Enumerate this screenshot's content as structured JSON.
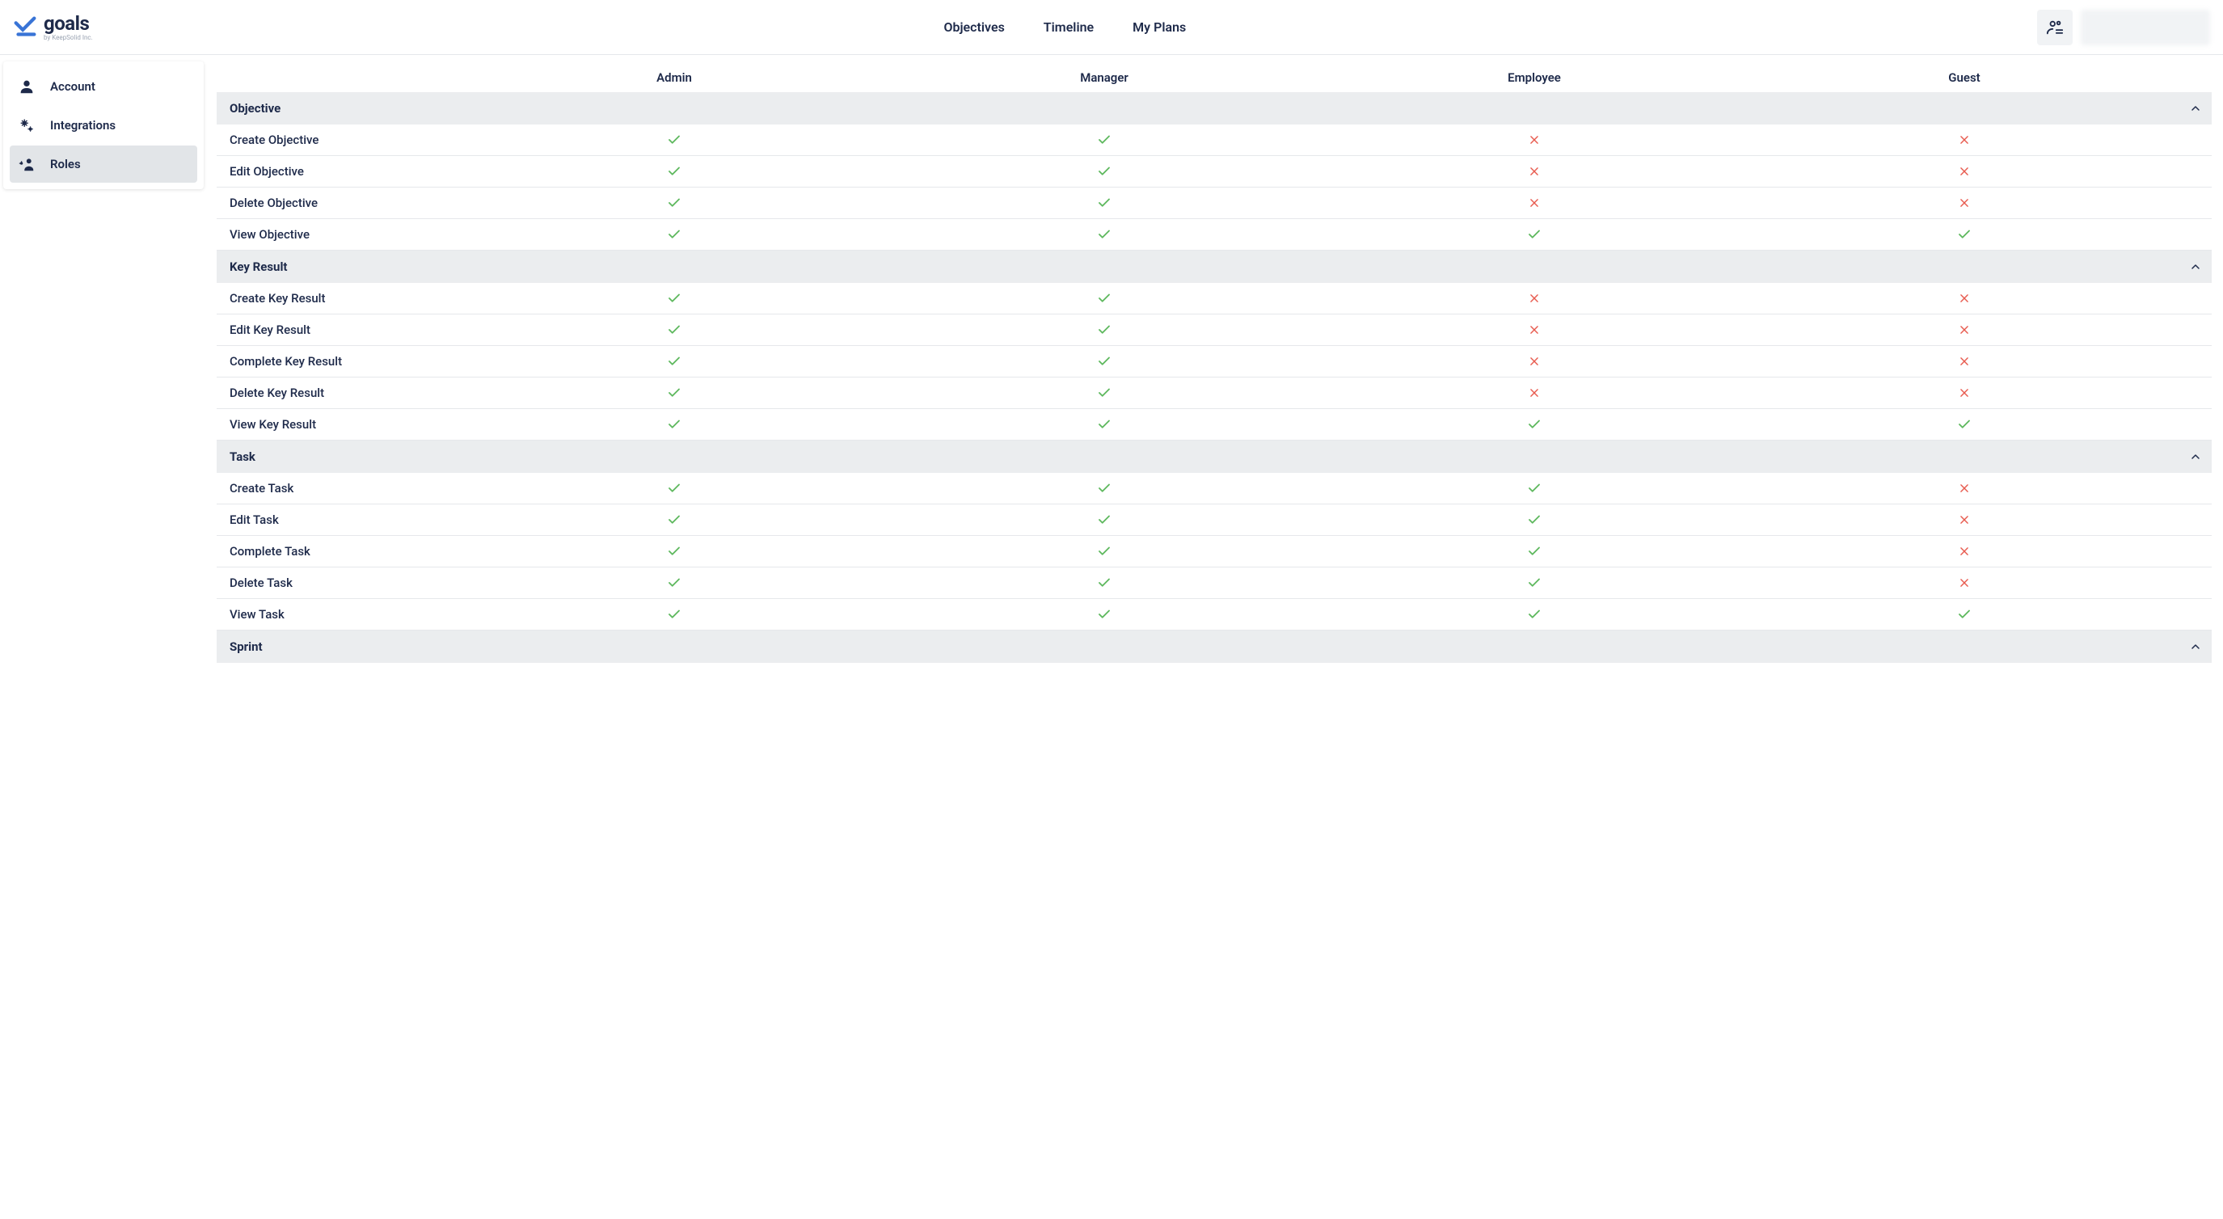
{
  "logo": {
    "title": "goals",
    "subtitle": "by KeepSolid Inc."
  },
  "nav": {
    "objectives": "Objectives",
    "timeline": "Timeline",
    "myplans": "My Plans"
  },
  "sidebar": {
    "items": [
      {
        "label": "Account"
      },
      {
        "label": "Integrations"
      },
      {
        "label": "Roles"
      }
    ]
  },
  "table": {
    "columns": [
      "",
      "Admin",
      "Manager",
      "Employee",
      "Guest"
    ],
    "sections": [
      {
        "title": "Objective",
        "rows": [
          {
            "label": "Create Objective",
            "cells": [
              true,
              true,
              false,
              false
            ]
          },
          {
            "label": "Edit Objective",
            "cells": [
              true,
              true,
              false,
              false
            ]
          },
          {
            "label": "Delete Objective",
            "cells": [
              true,
              true,
              false,
              false
            ]
          },
          {
            "label": "View Objective",
            "cells": [
              true,
              true,
              true,
              true
            ]
          }
        ]
      },
      {
        "title": "Key Result",
        "rows": [
          {
            "label": "Create Key Result",
            "cells": [
              true,
              true,
              false,
              false
            ]
          },
          {
            "label": "Edit Key Result",
            "cells": [
              true,
              true,
              false,
              false
            ]
          },
          {
            "label": "Complete Key Result",
            "cells": [
              true,
              true,
              false,
              false
            ]
          },
          {
            "label": "Delete Key Result",
            "cells": [
              true,
              true,
              false,
              false
            ]
          },
          {
            "label": "View Key Result",
            "cells": [
              true,
              true,
              true,
              true
            ]
          }
        ]
      },
      {
        "title": "Task",
        "rows": [
          {
            "label": "Create Task",
            "cells": [
              true,
              true,
              true,
              false
            ]
          },
          {
            "label": "Edit Task",
            "cells": [
              true,
              true,
              true,
              false
            ]
          },
          {
            "label": "Complete Task",
            "cells": [
              true,
              true,
              true,
              false
            ]
          },
          {
            "label": "Delete Task",
            "cells": [
              true,
              true,
              true,
              false
            ]
          },
          {
            "label": "View Task",
            "cells": [
              true,
              true,
              true,
              true
            ]
          }
        ]
      },
      {
        "title": "Sprint",
        "rows": []
      }
    ]
  }
}
